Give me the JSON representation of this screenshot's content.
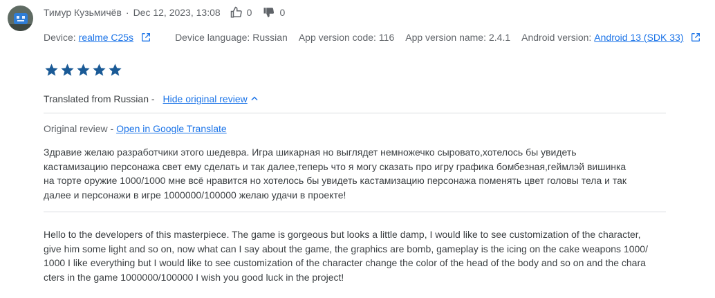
{
  "review": {
    "author": "Тимур Кузьмичёв",
    "date": "Dec 12, 2023, 13:08",
    "thumbs_up_count": "0",
    "thumbs_down_count": "0",
    "rating": 5,
    "star_color": "#1a5a96"
  },
  "device": {
    "device_label": "Device:",
    "device_value": "realme C25s",
    "language_label": "Device language:",
    "language_value": "Russian",
    "app_code_label": "App version code:",
    "app_code_value": "116",
    "app_name_label": "App version name:",
    "app_name_value": "2.4.1",
    "android_label": "Android version:",
    "android_value": "Android 13 (SDK 33)"
  },
  "translation": {
    "translated_from": "Translated from Russian -",
    "hide_link": "Hide original review",
    "original_label": "Original review -",
    "open_translate_link": "Open in Google Translate"
  },
  "original_text_lines": [
    "Здравие желаю разработчики этого шедевра. Игра шикарная но выглядет немножечко сыровато,хотелось бы увидеть",
    "кастамизацию персонажа свет ему сделать и так далее,теперь что я могу сказать про игру графика бомбезная,геймлэй вишинка",
    "на торте оружие 1000/1000 мне всё нравится но хотелось бы увидеть кастамизацию персонажа поменять цвет головы тела и так",
    "далее и персонажи в игре 1000000/100000 желаю удачи в проекте!"
  ],
  "translated_text_lines": [
    "Hello to the developers of this masterpiece. The game is gorgeous but looks a little damp, I would like to see customization of the character,",
    "give him some light and so on, now what can I say about the game, the graphics are bomb, gameplay is the icing on the cake weapons 1000/",
    "1000 I like everything but I would like to see customization of the character change the color of the head of the body and so on and the chara",
    "cters in the game 1000000/100000 I wish you good luck in the project!"
  ]
}
